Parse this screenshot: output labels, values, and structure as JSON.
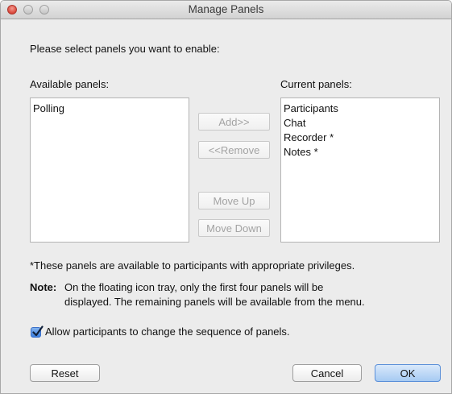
{
  "window": {
    "title": "Manage Panels"
  },
  "prompt": "Please select panels you want to enable:",
  "available": {
    "label": "Available panels:",
    "items": [
      "Polling"
    ]
  },
  "current": {
    "label": "Current panels:",
    "items": [
      "Participants",
      "Chat",
      "Recorder *",
      "Notes *"
    ]
  },
  "buttons": {
    "add": "Add>>",
    "remove": "<<Remove",
    "move_up": "Move Up",
    "move_down": "Move Down",
    "reset": "Reset",
    "cancel": "Cancel",
    "ok": "OK"
  },
  "footnote": "*These panels are available to participants with appropriate privileges.",
  "note": {
    "label": "Note:",
    "line1": "On the floating icon tray, only the first four panels will be",
    "line2": "displayed. The remaining panels will be available from the menu."
  },
  "checkbox": {
    "label": "Allow participants to change the sequence of panels.",
    "checked": true
  },
  "colors": {
    "accent": "#3d80df",
    "close": "#d9463a"
  }
}
